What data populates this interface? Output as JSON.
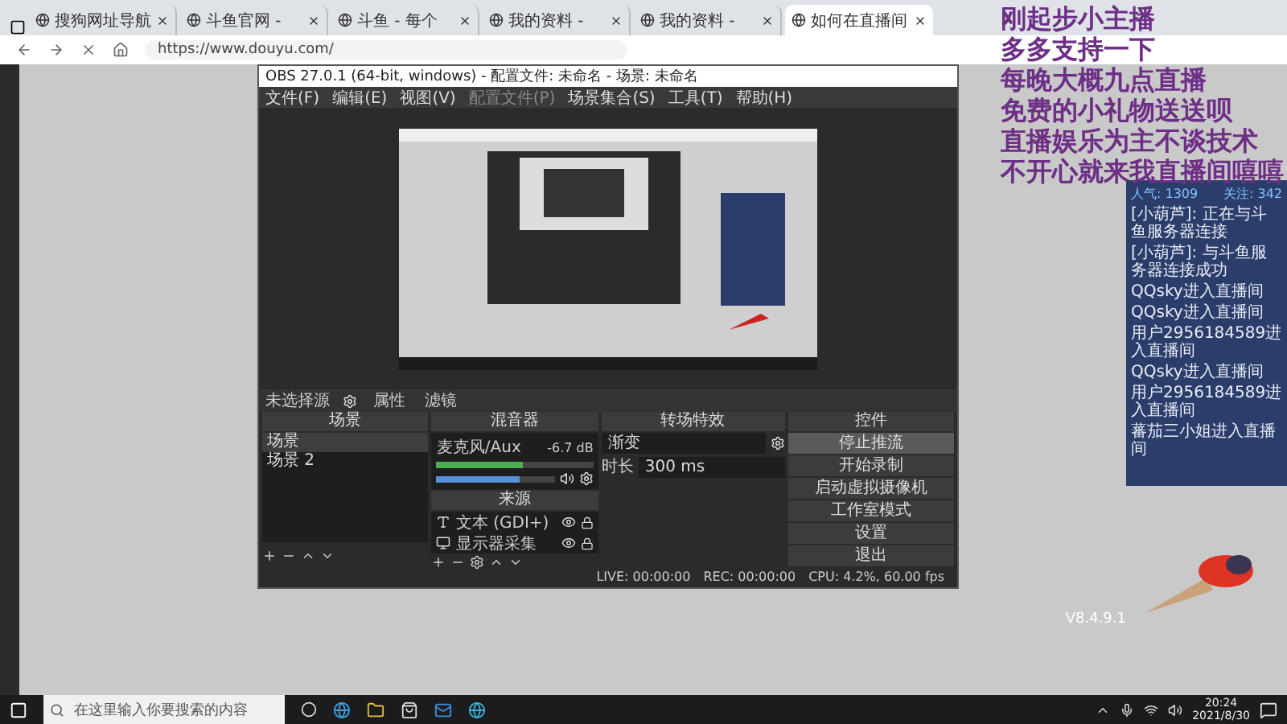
{
  "browser": {
    "tabs": [
      {
        "title": "搜狗网址导航",
        "selected": false
      },
      {
        "title": "斗鱼官网 -",
        "selected": false
      },
      {
        "title": "斗鱼 - 每个",
        "selected": false
      },
      {
        "title": "我的资料 -",
        "selected": false
      },
      {
        "title": "我的资料 -",
        "selected": false
      },
      {
        "title": "如何在直播间",
        "selected": true
      }
    ],
    "address": "https://www.douyu.com/"
  },
  "obs": {
    "title": "OBS 27.0.1 (64-bit, windows) - 配置文件: 未命名 - 场景: 未命名",
    "menu": [
      "文件(F)",
      "编辑(E)",
      "视图(V)",
      "配置文件(P)",
      "场景集合(S)",
      "工具(T)",
      "帮助(H)"
    ],
    "source_bar": {
      "label": "未选择源",
      "buttons": [
        "属性",
        "滤镜"
      ]
    },
    "scenes": {
      "title": "场景",
      "items": [
        {
          "name": "场景",
          "selected": true
        },
        {
          "name": "场景 2",
          "selected": false
        }
      ]
    },
    "mixer": {
      "title": "混音器",
      "channel": {
        "name": "麦克风/Aux",
        "reading": "-6.7 dB",
        "meter": {
          "level": 0.55
        },
        "volume": {
          "level": 0.7
        }
      }
    },
    "sources": {
      "title": "来源",
      "items": [
        {
          "kind": "text",
          "name": "文本 (GDI+)",
          "visible": true
        },
        {
          "kind": "display",
          "name": "显示器采集",
          "visible": true
        }
      ]
    },
    "transitions": {
      "title": "转场特效",
      "type": "渐变",
      "duration_label": "时长",
      "duration": "300 ms"
    },
    "controls": {
      "title": "控件",
      "buttons": [
        {
          "label": "停止推流",
          "active": true
        },
        {
          "label": "开始录制",
          "active": false
        },
        {
          "label": "启动虚拟摄像机",
          "active": false
        },
        {
          "label": "工作室模式",
          "active": false
        },
        {
          "label": "设置",
          "active": false
        },
        {
          "label": "退出",
          "active": false
        }
      ]
    },
    "status": {
      "live": "LIVE: 00:00:00",
      "rec": "REC: 00:00:00",
      "cpu": "CPU: 4.2%, 60.00 fps"
    }
  },
  "overlay_lines": [
    "刚起步小主播",
    "多多支持一下",
    "每晚大概九点直播",
    "免费的小礼物送送呗",
    "直播娱乐为主不谈技术",
    "不开心就来我直播间嘻嘻"
  ],
  "chat": {
    "stats": [
      "人气: 1309",
      "关注: 342"
    ],
    "messages": [
      "[小葫芦]: 正在与斗鱼服务器连接",
      "[小葫芦]: 与斗鱼服务器连接成功",
      "QQsky进入直播间",
      "QQsky进入直播间",
      "用户2956184589进入直播间",
      "QQsky进入直播间",
      "用户2956184589进入直播间",
      "蕃茄三小姐进入直播间"
    ]
  },
  "helper": {
    "version": "V8.4.9.1"
  },
  "taskbar": {
    "search_placeholder": "在这里输入你要搜索的内容",
    "time": "20:24",
    "date": "2021/8/30"
  }
}
